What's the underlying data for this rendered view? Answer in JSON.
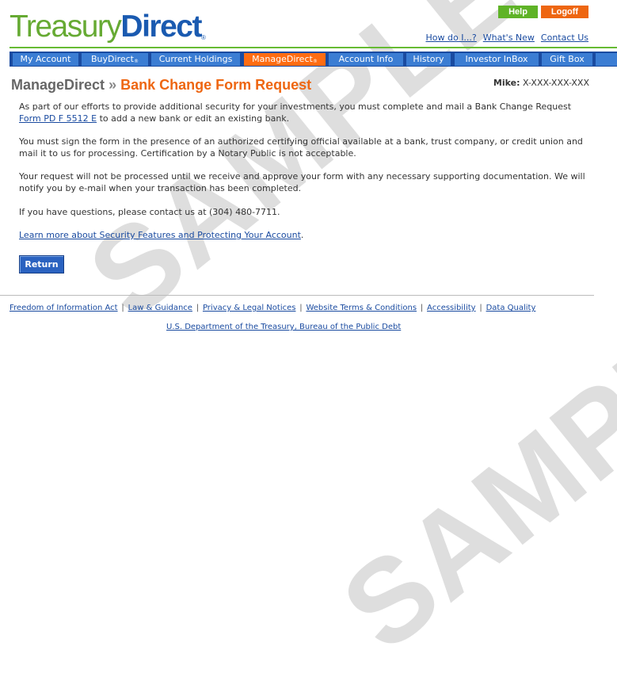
{
  "logo": {
    "part1": "Treasury",
    "part2": "Direct",
    "reg": "®"
  },
  "header": {
    "help_label": "Help",
    "logoff_label": "Logoff",
    "links": [
      "How do I...?",
      "What's New",
      "Contact Us"
    ]
  },
  "nav": {
    "tabs": [
      {
        "label": "My Account"
      },
      {
        "label": "BuyDirect",
        "mark": "®"
      },
      {
        "label": "Current Holdings"
      },
      {
        "label": "ManageDirect",
        "mark": "®",
        "active": true
      },
      {
        "label": "Account Info"
      },
      {
        "label": "History"
      },
      {
        "label": "Investor InBox"
      },
      {
        "label": "Gift Box"
      }
    ]
  },
  "page": {
    "section": "ManageDirect",
    "separator": "»",
    "title": "Bank Change Form Request",
    "account_name": "Mike:",
    "account_number": "X-XXX-XXX-XXX"
  },
  "body": {
    "p1_before": "As part of our efforts to provide additional security for your investments, you must complete and mail a Bank Change Request ",
    "p1_link": "Form PD F 5512 E",
    "p1_after": " to add a new bank or edit an existing bank.",
    "p2": "You must sign the form in the presence of an authorized certifying official available at a bank, trust company, or credit union and mail it to us for processing. Certification by a Notary Public is not acceptable.",
    "p3": "Your request will not be processed until we receive and approve your form with any necessary supporting documentation. We will notify you by e-mail when your transaction has been completed.",
    "p4": "If you have questions, please contact us at (304) 480-7711.",
    "learn_link": "Learn more about Security Features and Protecting Your Account",
    "learn_after": ".",
    "return_label": "Return"
  },
  "watermark": {
    "text": "SAMPLE"
  },
  "footer": {
    "links": [
      "Freedom of Information Act",
      "Law & Guidance",
      "Privacy & Legal Notices",
      "Website Terms & Conditions",
      "Accessibility",
      "Data Quality"
    ],
    "separator": "|",
    "agency": "U.S. Department of the Treasury, Bureau of the Public Debt"
  },
  "colors": {
    "brand_green": "#66aa33",
    "brand_blue": "#1a5ab0",
    "nav_blue": "#3b7dd3",
    "active_orange": "#ff6c12",
    "title_orange": "#ee6611"
  }
}
